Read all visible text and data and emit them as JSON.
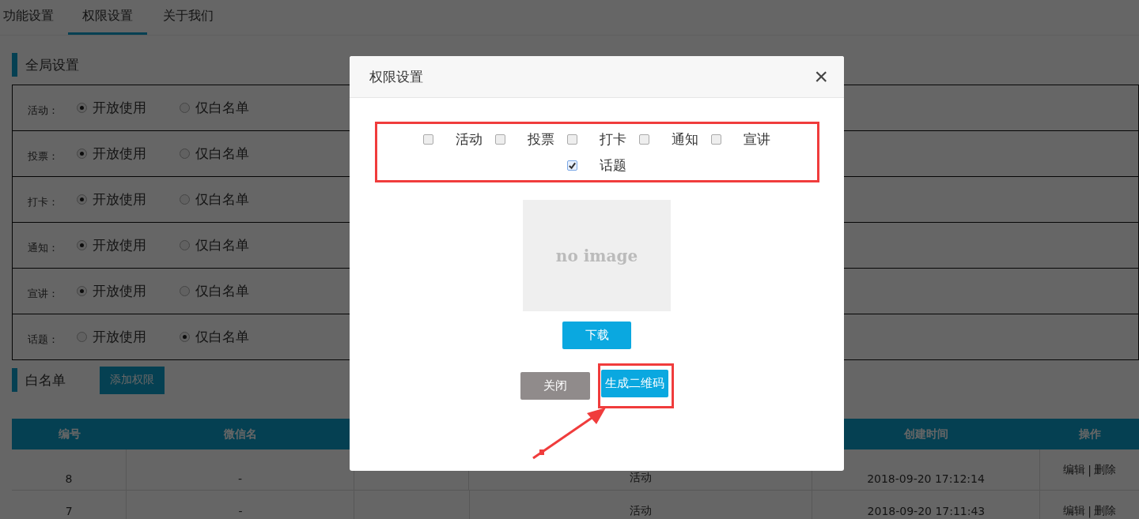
{
  "tabs": [
    {
      "label": "功能设置",
      "selected": false
    },
    {
      "label": "权限设置",
      "selected": true
    },
    {
      "label": "关于我们",
      "selected": false
    }
  ],
  "global_settings": {
    "title": "全局设置",
    "rows": [
      {
        "label": "活动：",
        "options": [
          {
            "label": "开放使用",
            "selected": true
          },
          {
            "label": "仅白名单",
            "selected": false
          }
        ]
      },
      {
        "label": "投票：",
        "options": [
          {
            "label": "开放使用",
            "selected": true
          },
          {
            "label": "仅白名单",
            "selected": false
          }
        ]
      },
      {
        "label": "打卡：",
        "options": [
          {
            "label": "开放使用",
            "selected": true
          },
          {
            "label": "仅白名单",
            "selected": false
          }
        ]
      },
      {
        "label": "通知：",
        "options": [
          {
            "label": "开放使用",
            "selected": true
          },
          {
            "label": "仅白名单",
            "selected": false
          }
        ]
      },
      {
        "label": "宣讲：",
        "options": [
          {
            "label": "开放使用",
            "selected": true
          },
          {
            "label": "仅白名单",
            "selected": false
          }
        ]
      },
      {
        "label": "话题：",
        "options": [
          {
            "label": "开放使用",
            "selected": false
          },
          {
            "label": "仅白名单",
            "selected": true
          }
        ]
      }
    ]
  },
  "whitelist": {
    "title": "白名单",
    "add_button": "添加权限",
    "table": {
      "columns": [
        "编号",
        "微信名",
        "",
        "",
        "创建时间",
        "操作"
      ],
      "rows": [
        {
          "cells": [
            "8",
            "-",
            "",
            "活动",
            "2018-09-20 17:12:14"
          ],
          "edit": "编辑",
          "sep": "|",
          "delete": "删除"
        },
        {
          "cells": [
            "7",
            "-",
            "",
            "活动",
            "2018-09-20 17:11:43"
          ],
          "edit": "编辑",
          "sep": "|",
          "delete": "删除"
        }
      ]
    }
  },
  "modal": {
    "title": "权限设置",
    "close": "×",
    "options": [
      {
        "label": "活动",
        "checked": false
      },
      {
        "label": "投票",
        "checked": false
      },
      {
        "label": "打卡",
        "checked": false
      },
      {
        "label": "通知",
        "checked": false
      },
      {
        "label": "宣讲",
        "checked": false
      },
      {
        "label": "话题",
        "checked": true
      }
    ],
    "image_placeholder": "no image",
    "download_button": "下载",
    "close_button": "关闭",
    "generate_button": "生成二维码",
    "highlight_options": true,
    "highlight_generate": true,
    "arrow": true
  }
}
